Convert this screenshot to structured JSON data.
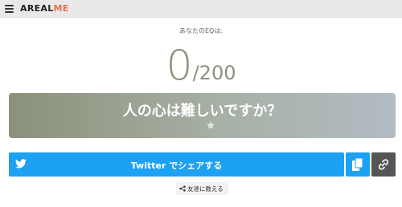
{
  "header": {
    "logo_main": "AREAL",
    "logo_accent": "ME",
    "menu_icon": "hamburger-menu-icon"
  },
  "result": {
    "label": "あなたのEQは:",
    "score": "0",
    "max": "/200",
    "title": "人の心は難しいですか？",
    "rating_icon": "star-icon"
  },
  "share": {
    "twitter_label": "Twitter でシェアする",
    "twitter_icon": "twitter-bird-icon",
    "copy_icon": "copy-icon",
    "link_icon": "link-icon",
    "friends_label": "友達に教える",
    "friends_icon": "share-icon"
  },
  "colors": {
    "twitter_blue": "#1da1f2",
    "logo_accent": "#e8704a",
    "score_text": "#8c917d",
    "link_button": "#555555"
  }
}
